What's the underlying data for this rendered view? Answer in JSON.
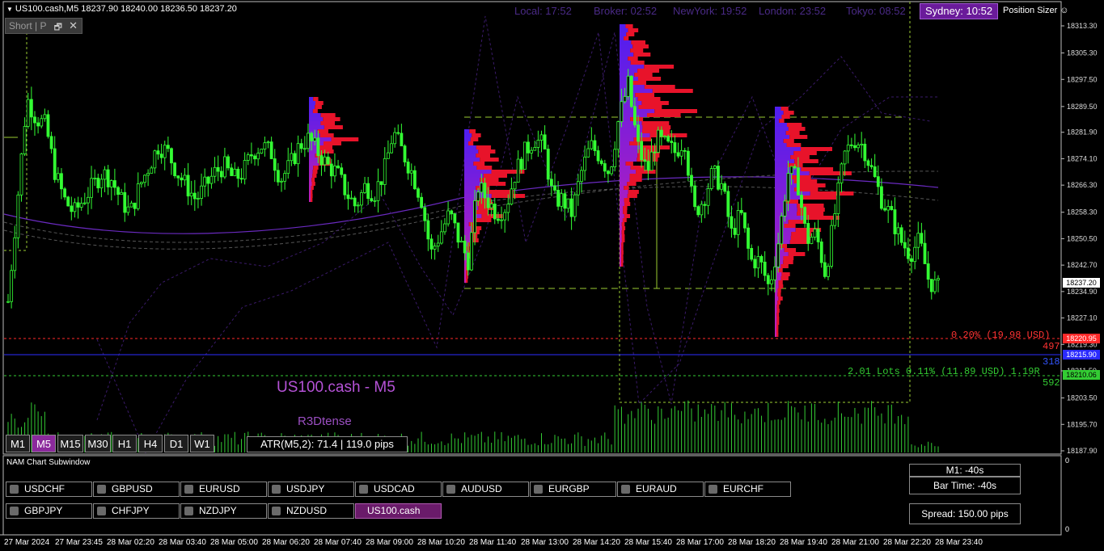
{
  "symbol_info": "US100.cash,M5  18237.90 18240.00 18236.50 18237.20",
  "panel_button": {
    "label": "Short | P",
    "restore": "🗗",
    "close": "✕"
  },
  "sessions": [
    {
      "label": "Local: 17:52"
    },
    {
      "label": "Broker: 02:52"
    },
    {
      "label": "NewYork: 19:52"
    },
    {
      "label": "London: 23:52"
    },
    {
      "label": "Tokyo: 08:52"
    }
  ],
  "sydney_label": "Sydney: 10:52",
  "position_sizer": "Position Sizer ☺",
  "chart_title": "US100.cash - M5",
  "chart_author": "R3Dtense",
  "timeframes": [
    {
      "label": "M1",
      "active": false
    },
    {
      "label": "M5",
      "active": true
    },
    {
      "label": "M15",
      "active": false
    },
    {
      "label": "M30",
      "active": false
    },
    {
      "label": "H1",
      "active": false
    },
    {
      "label": "H4",
      "active": false
    },
    {
      "label": "D1",
      "active": false
    },
    {
      "label": "W1",
      "active": false
    }
  ],
  "atr_label": "ATR(M5,2): 71.4  |  119.0 pips",
  "price_axis": [
    "18313.30",
    "18305.30",
    "18297.50",
    "18289.50",
    "18281.90",
    "18274.10",
    "18266.30",
    "18258.30",
    "18250.50",
    "18242.70",
    "18234.90",
    "18227.10",
    "18219.30",
    "18211.50",
    "18203.50",
    "18195.70",
    "18187.90"
  ],
  "current_price": "18237.20",
  "sl_price": "18220.95",
  "entry_price": "18215.90",
  "tp_price": "18210.06",
  "risk_label": "0.20% (19.98 USD)",
  "risk_pips": "497",
  "entry_pips": "318",
  "lots_label": "2.01 Lots 0.11% (11.89 USD) 1.19R",
  "tp_pips": "592",
  "subwindow": {
    "title": "NAM Chart Subwindow",
    "axis_top": "0",
    "axis_bottom": "0",
    "pairs_row1": [
      "USDCHF",
      "GBPUSD",
      "EURUSD",
      "USDJPY",
      "USDCAD",
      "AUDUSD",
      "EURGBP",
      "EURAUD",
      "EURCHF"
    ],
    "pairs_row2": [
      "GBPJPY",
      "CHFJPY",
      "NZDJPY",
      "NZDUSD",
      "US100.cash"
    ],
    "selected_pair": "US100.cash",
    "m1_label": "M1:  -40s",
    "bar_time_label": "Bar Time: -40s",
    "spread_label": "Spread: 150.00 pips"
  },
  "time_axis": [
    "27 Mar 2024",
    "27 Mar 23:45",
    "28 Mar 02:20",
    "28 Mar 03:40",
    "28 Mar 05:00",
    "28 Mar 06:20",
    "28 Mar 07:40",
    "28 Mar 09:00",
    "28 Mar 10:20",
    "28 Mar 11:40",
    "28 Mar 13:00",
    "28 Mar 14:20",
    "28 Mar 15:40",
    "28 Mar 17:00",
    "28 Mar 18:20",
    "28 Mar 19:40",
    "28 Mar 21:00",
    "28 Mar 22:20",
    "28 Mar 23:40"
  ],
  "colors": {
    "candles": "#33ff33",
    "profile_low": "#3b1cff",
    "profile_high": "#ff1a2a",
    "box_lines": "#9acd32",
    "stop_loss": "#ff2a2a",
    "entry": "#2b2bff",
    "take_profit": "#33cc33",
    "sydney_bg": "#6a1b9a"
  },
  "chart_data": {
    "type": "candlestick",
    "symbol": "US100.cash",
    "timeframe": "M5",
    "y_range": [
      18187.9,
      18318
    ],
    "close_path": [
      18232,
      18262,
      18292,
      18286,
      18284,
      18270,
      18262,
      18258,
      18262,
      18266,
      18270,
      18268,
      18262,
      18258,
      18266,
      18272,
      18278,
      18276,
      18270,
      18266,
      18262,
      18266,
      18270,
      18272,
      18268,
      18270,
      18276,
      18278,
      18276,
      18268,
      18272,
      18278,
      18280,
      18276,
      18272,
      18270,
      18264,
      18260,
      18266,
      18264,
      18270,
      18282,
      18276,
      18270,
      18262,
      18246,
      18252,
      18258,
      18250,
      18244,
      18266,
      18262,
      18258,
      18260,
      18270,
      18276,
      18280,
      18278,
      18262,
      18262,
      18258,
      18270,
      18278,
      18275,
      18270,
      18286,
      18296,
      18278,
      18270,
      18280,
      18278,
      18276,
      18280,
      18258,
      18262,
      18270,
      18266,
      18252,
      18258,
      18244,
      18244,
      18236,
      18250,
      18270,
      18268,
      18250,
      18252,
      18240,
      18258,
      18275,
      18280,
      18278,
      18270,
      18262,
      18257,
      18250,
      18246,
      18250,
      18238,
      18236
    ],
    "stop_loss": 18220.95,
    "entry": 18215.9,
    "take_profit": 18210.06,
    "current": 18237.2
  }
}
